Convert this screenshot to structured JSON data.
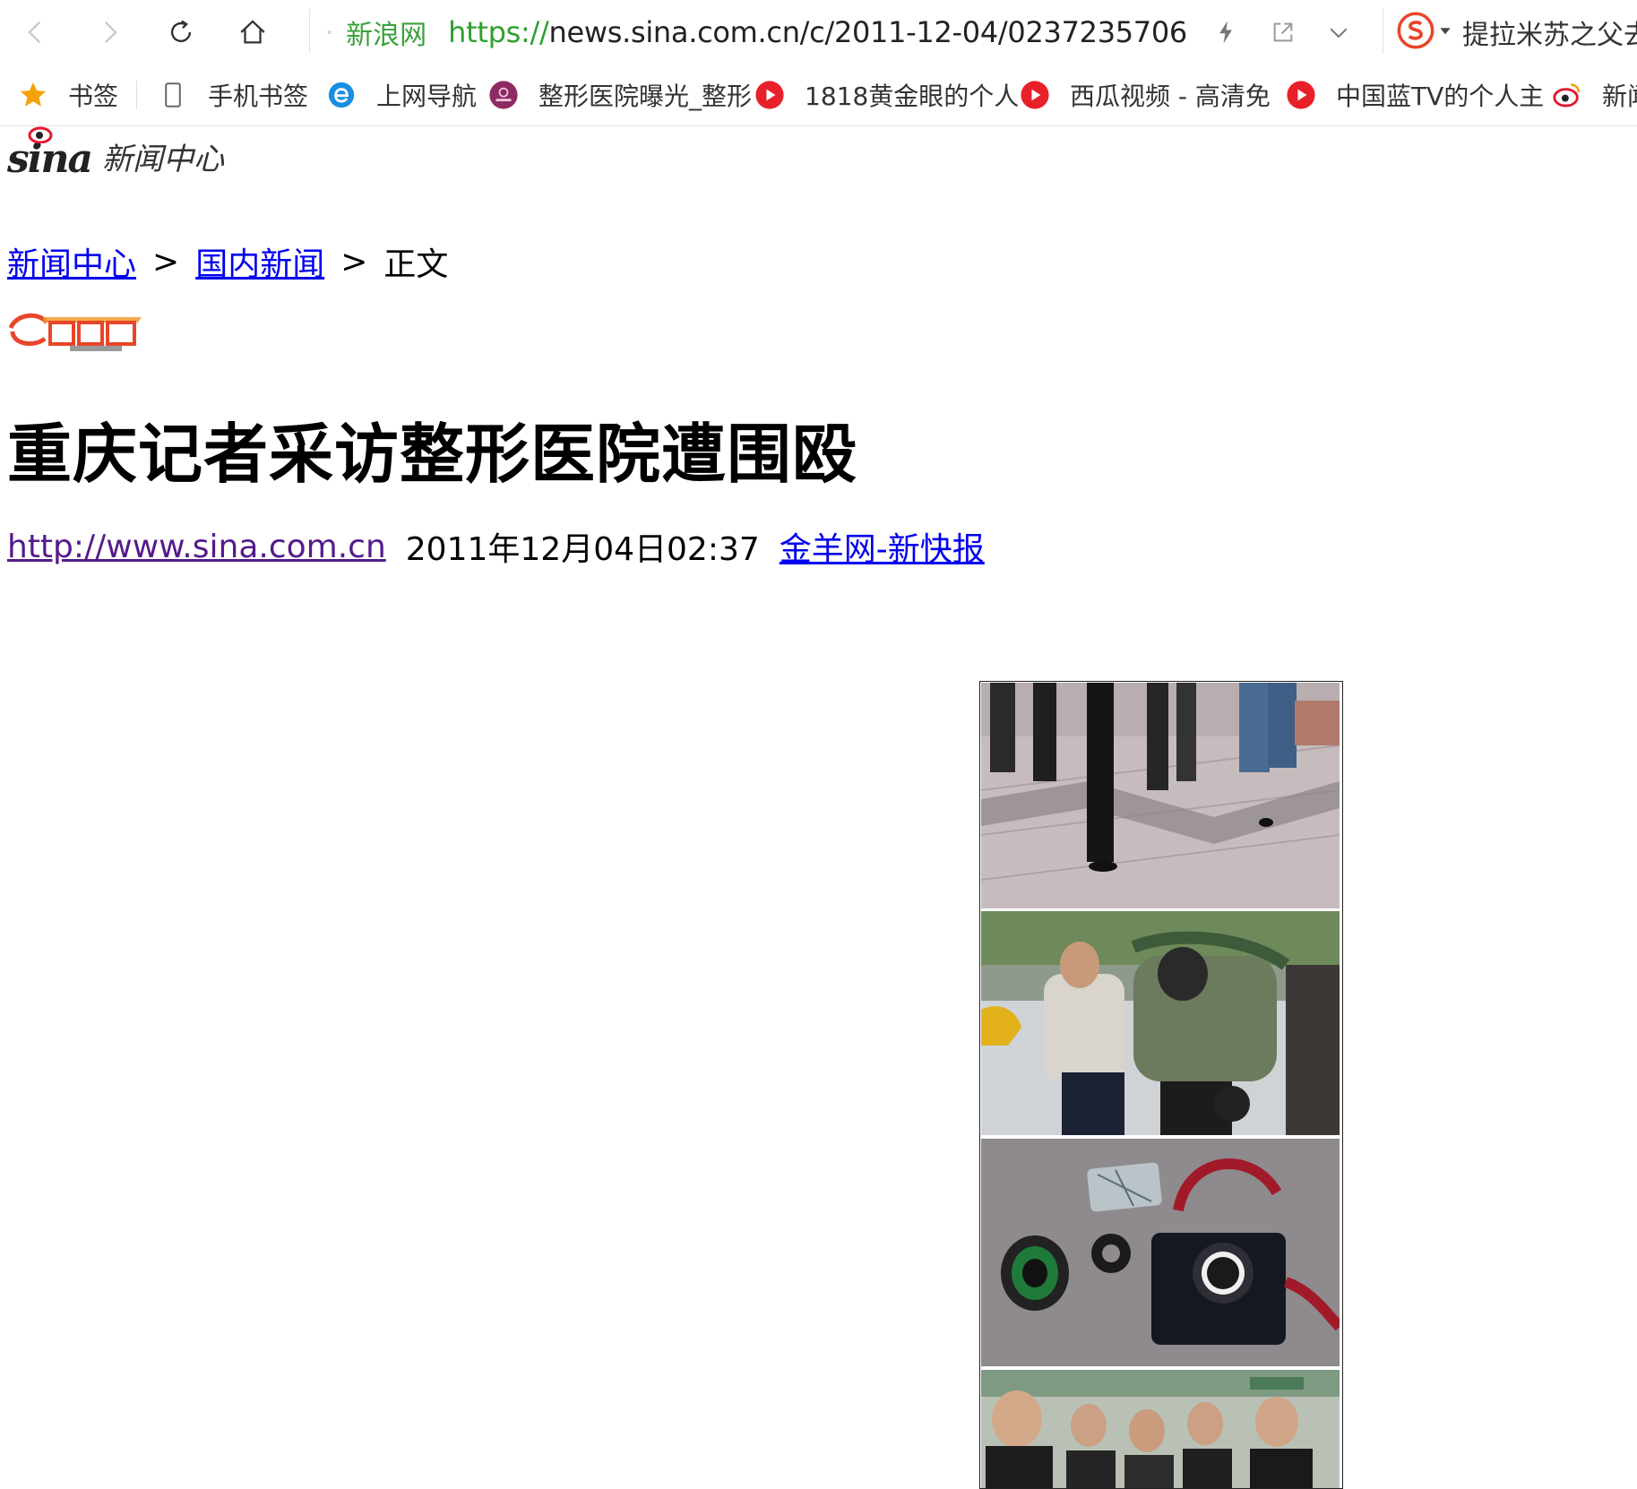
{
  "browser": {
    "address": {
      "site_label": "新浪网",
      "url_scheme": "https://",
      "url_rest": "news.sina.com.cn/c/2011-12-04/023723570​6"
    },
    "search_text": "提拉米苏之父去",
    "icons": {
      "back": "back-arrow-icon",
      "forward": "forward-arrow-icon",
      "reload": "reload-icon",
      "home": "home-icon",
      "bookmark_star": "star-outline-icon",
      "lightning": "lightning-icon",
      "share": "share-icon",
      "dropdown": "chevron-down-icon",
      "search_engine": "sogou-search-icon"
    },
    "accent_color": "#3aa13a"
  },
  "bookmarks": [
    {
      "label": "书签",
      "icon": "star-filled-icon"
    },
    {
      "label": "手机书签",
      "icon": "phone-icon"
    },
    {
      "label": "上网导航",
      "icon": "ie-e-icon"
    },
    {
      "label": "整形医院曝光_整形",
      "icon": "flower-logo-icon"
    },
    {
      "label": "1818黄金眼的个人",
      "icon": "red-play-icon"
    },
    {
      "label": "西瓜视频 - 高清免",
      "icon": "red-play-icon"
    },
    {
      "label": "中国蓝TV的个人主",
      "icon": "red-play-icon"
    },
    {
      "label": "新闻",
      "icon": "weibo-eye-icon"
    }
  ],
  "page": {
    "logo": {
      "brand": "sina",
      "section": "新闻中心"
    },
    "breadcrumb": {
      "items": [
        "新闻中心",
        "国内新闻"
      ],
      "separator": ">",
      "current": "正文"
    },
    "media_logo": "jinyang-net-logo",
    "headline": "重庆记者采访整形医院遭围殴",
    "byline": {
      "link": "http://www.sina.com.cn",
      "datetime": "2011年12月04日02:37",
      "source": "金羊网-新快报"
    },
    "photo_panels": [
      "street-feet-photo",
      "scuffle-photo",
      "broken-camera-photo",
      "men-group-photo"
    ]
  }
}
